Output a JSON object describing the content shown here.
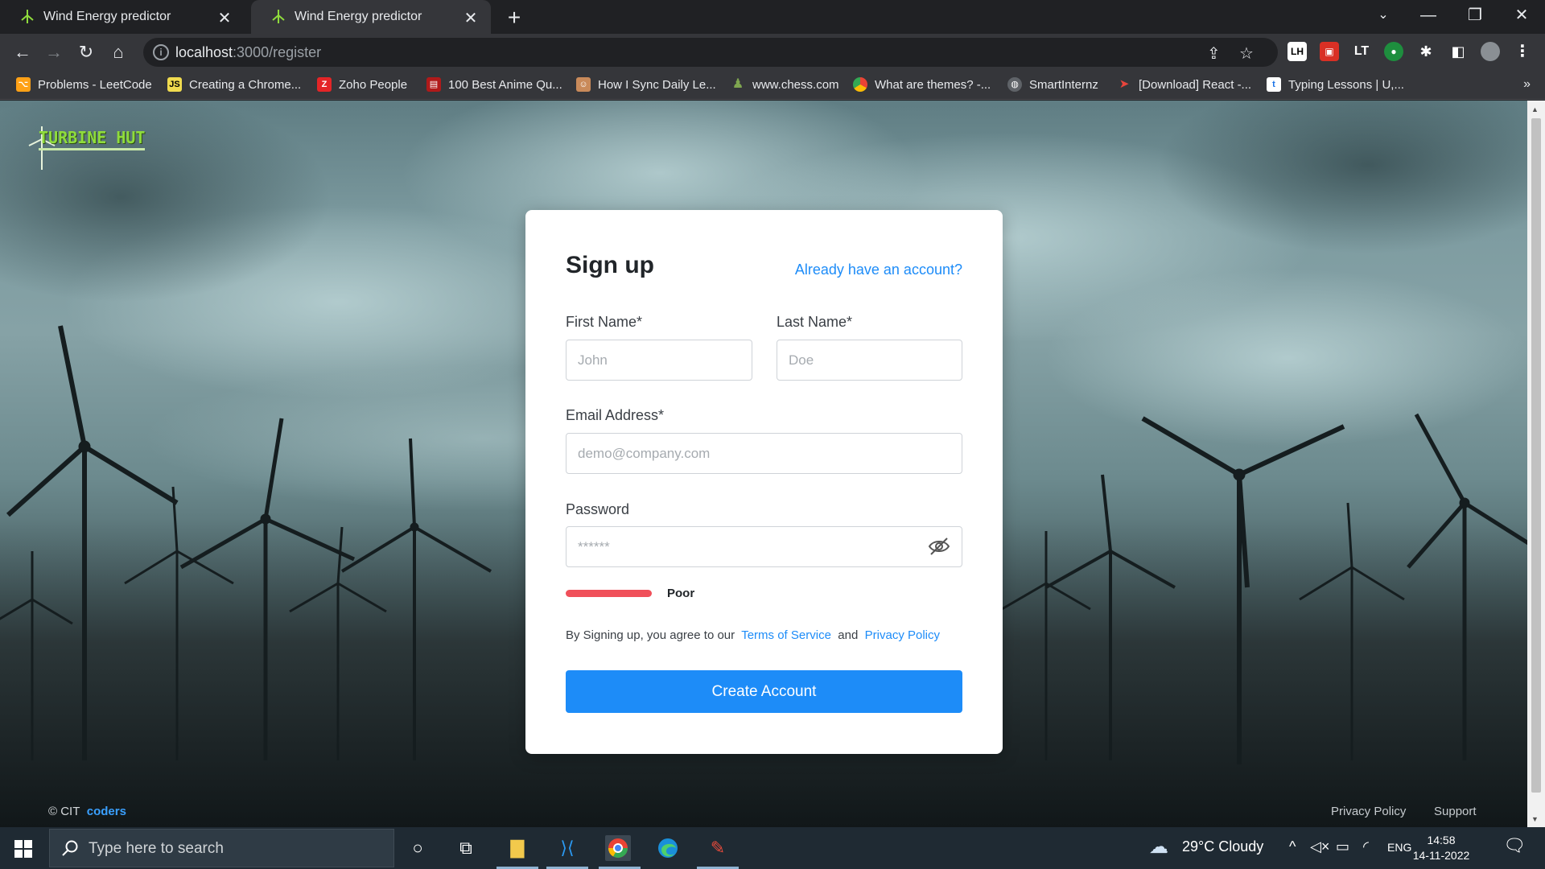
{
  "browser": {
    "tabs": [
      {
        "title": "Wind Energy predictor",
        "close": "✕"
      },
      {
        "title": "Wind Energy predictor",
        "close": "✕"
      }
    ],
    "new_tab": "+",
    "url_host": "localhost",
    "url_path": ":3000/register",
    "bookmarks": [
      {
        "label": "Problems - LeetCode",
        "icon": "leetcode-icon"
      },
      {
        "label": "Creating a Chrome...",
        "icon": "js-icon"
      },
      {
        "label": "Zoho People",
        "icon": "zoho-icon"
      },
      {
        "label": "100 Best Anime Qu...",
        "icon": "anime-icon"
      },
      {
        "label": "How I Sync Daily Le...",
        "icon": "sync-icon"
      },
      {
        "label": "www.chess.com",
        "icon": "chess-icon"
      },
      {
        "label": "What are themes? -...",
        "icon": "chrome-icon"
      },
      {
        "label": "SmartInternz",
        "icon": "globe-icon"
      },
      {
        "label": "[Download] React -...",
        "icon": "react-download-icon"
      },
      {
        "label": "Typing Lessons | U,...",
        "icon": "typing-icon"
      }
    ],
    "bookmarks_more": "»"
  },
  "brand": {
    "logo_text": "TURBINE HUT"
  },
  "form": {
    "title": "Sign up",
    "signin_link": "Already have an account?",
    "first_name_label": "First Name*",
    "first_name_placeholder": "John",
    "last_name_label": "Last Name*",
    "last_name_placeholder": "Doe",
    "email_label": "Email Address*",
    "email_placeholder": "demo@company.com",
    "password_label": "Password",
    "password_placeholder": "******",
    "strength_label": "Poor",
    "strength_fraction": 0.25,
    "terms_prefix": "By Signing up, you agree to our",
    "terms_link": "Terms of Service",
    "terms_and": "and",
    "privacy_link": "Privacy Policy",
    "submit_label": "Create Account"
  },
  "footer": {
    "copyright": "© CIT",
    "team": "coders",
    "privacy": "Privacy Policy",
    "support": "Support"
  },
  "taskbar": {
    "search_placeholder": "Type here to search",
    "weather": "29°C  Cloudy",
    "language": "ENG",
    "time": "14:58",
    "date": "14-11-2022"
  },
  "colors": {
    "accent": "#1d8cf8",
    "strength_poor": "#f0505a",
    "logo_green": "#8fdc3c"
  }
}
